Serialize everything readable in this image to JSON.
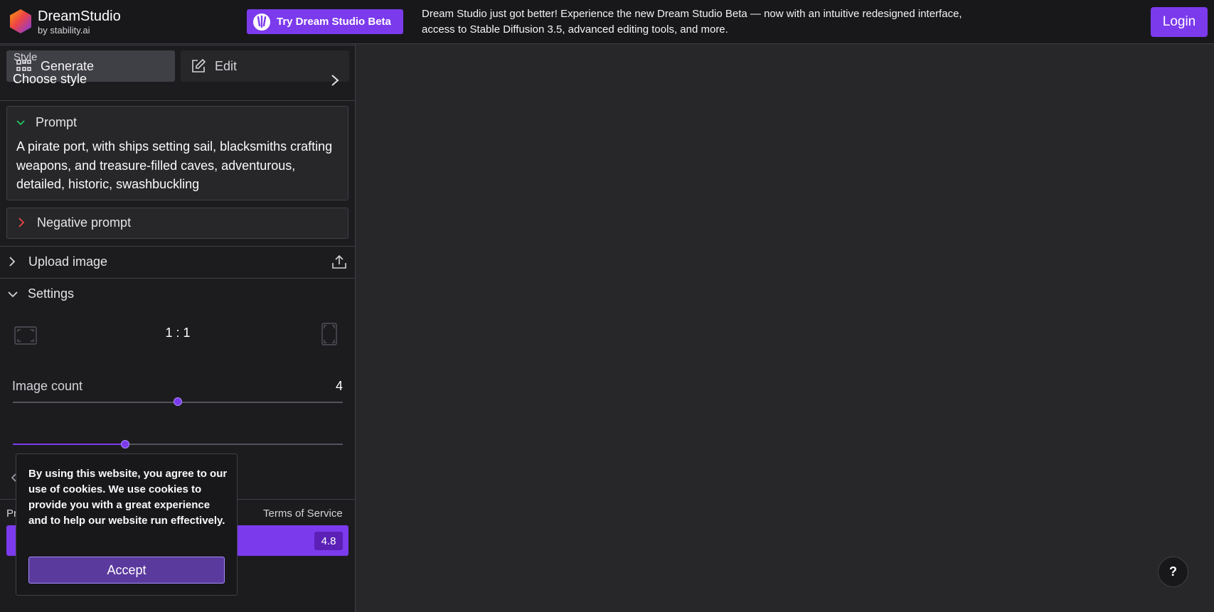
{
  "header": {
    "brand_name": "DreamStudio",
    "brand_sub": "by stability.ai",
    "beta_button_label": "Try Dream Studio Beta",
    "announcement": "Dream Studio just got better! Experience the new Dream Studio Beta — now with an intuitive redesigned interface, access to Stable Diffusion 3.5, advanced editing tools, and more.",
    "login_label": "Login"
  },
  "tabs": {
    "generate_label": "Generate",
    "edit_label": "Edit"
  },
  "style": {
    "label": "Style",
    "value": "Choose style"
  },
  "prompt": {
    "label": "Prompt",
    "text": "A pirate port, with ships setting sail, blacksmiths crafting weapons, and treasure-filled caves, adventurous, detailed, historic, swashbuckling"
  },
  "negative_prompt": {
    "label": "Negative prompt"
  },
  "upload": {
    "label": "Upload image"
  },
  "settings": {
    "label": "Settings",
    "aspect_ratio": "1 : 1",
    "aspect_slider_fraction": 0.5,
    "image_count_label": "Image count",
    "image_count": "4",
    "image_count_fraction": 0.34
  },
  "footer": {
    "privacy_partial": "Pr",
    "terms_label": "Terms of Service",
    "credit_cost": "4.8"
  },
  "cookie": {
    "text": "By using this website, you agree to our use of cookies. We use cookies to provide you with a great experience and to help our website run effectively.",
    "accept_label": "Accept"
  },
  "help": {
    "label": "?"
  },
  "icons": {
    "logo": "stability-hexagon-logo",
    "beta": "dream-studio-beta-icon",
    "generate": "grid-icon",
    "edit": "edit-pencil-icon",
    "style": "chevron-right-icon",
    "prompt": "chevron-down-icon",
    "negative": "chevron-right-icon",
    "upload": "upload-icon",
    "settings": "chevron-down-icon",
    "aspect_landscape": "landscape-frame-icon",
    "aspect_portrait": "portrait-frame-icon"
  },
  "colors": {
    "accent": "#7c3aed",
    "background": "#27272a",
    "panel": "#1c1c1f"
  }
}
